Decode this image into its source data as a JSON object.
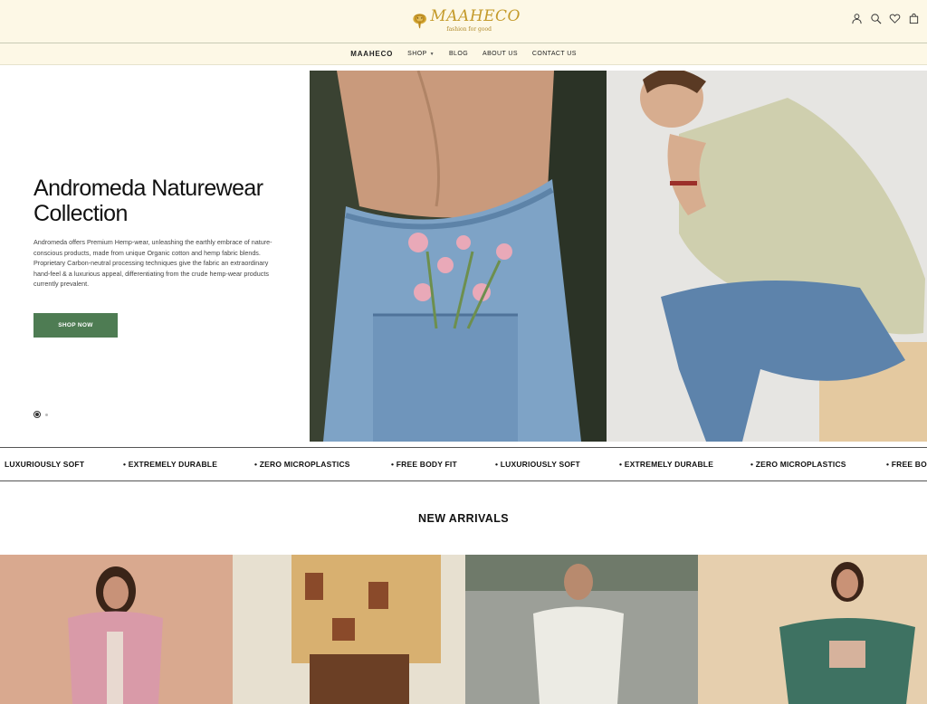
{
  "header": {
    "brand_name": "MAAHECO",
    "brand_tagline": "fashion for good",
    "icons": [
      "user-icon",
      "search-icon",
      "heart-icon",
      "cart-icon"
    ]
  },
  "nav": {
    "brand": "MAAHECO",
    "items": [
      {
        "label": "SHOP"
      },
      {
        "label": "BLOG"
      },
      {
        "label": "ABOUT US"
      },
      {
        "label": "CONTACT US"
      }
    ]
  },
  "hero": {
    "title": "Andromeda Naturewear Collection",
    "description_1": "Andromeda offers Premium Hemp-wear, unleashing the earthly embrace of nature-conscious products, made from unique Organic cotton and hemp fabric blends.",
    "description_2": "Proprietary Carbon-neutral processing techniques give the fabric an extraordinary hand-feel & a luxurious appeal, differentiating from the crude hemp-wear products currently prevalent.",
    "button_label": "SHOP NOW",
    "slide_count": 2,
    "active_slide": 1
  },
  "marquee": {
    "items": [
      "LUXURIOUSLY SOFT",
      "• EXTREMELY DURABLE",
      "• ZERO MICROPLASTICS",
      "• FREE BODY FIT",
      "• LUXURIOUSLY SOFT",
      "• EXTREMELY DURABLE",
      "• ZERO MICROPLASTICS",
      "• FREE BODY FIT"
    ]
  },
  "new_arrivals": {
    "title": "NEW ARRIVALS"
  },
  "colors": {
    "header_bg": "#fdf8e6",
    "brand_gold": "#c49a2a",
    "button_green": "#4e7c53"
  }
}
